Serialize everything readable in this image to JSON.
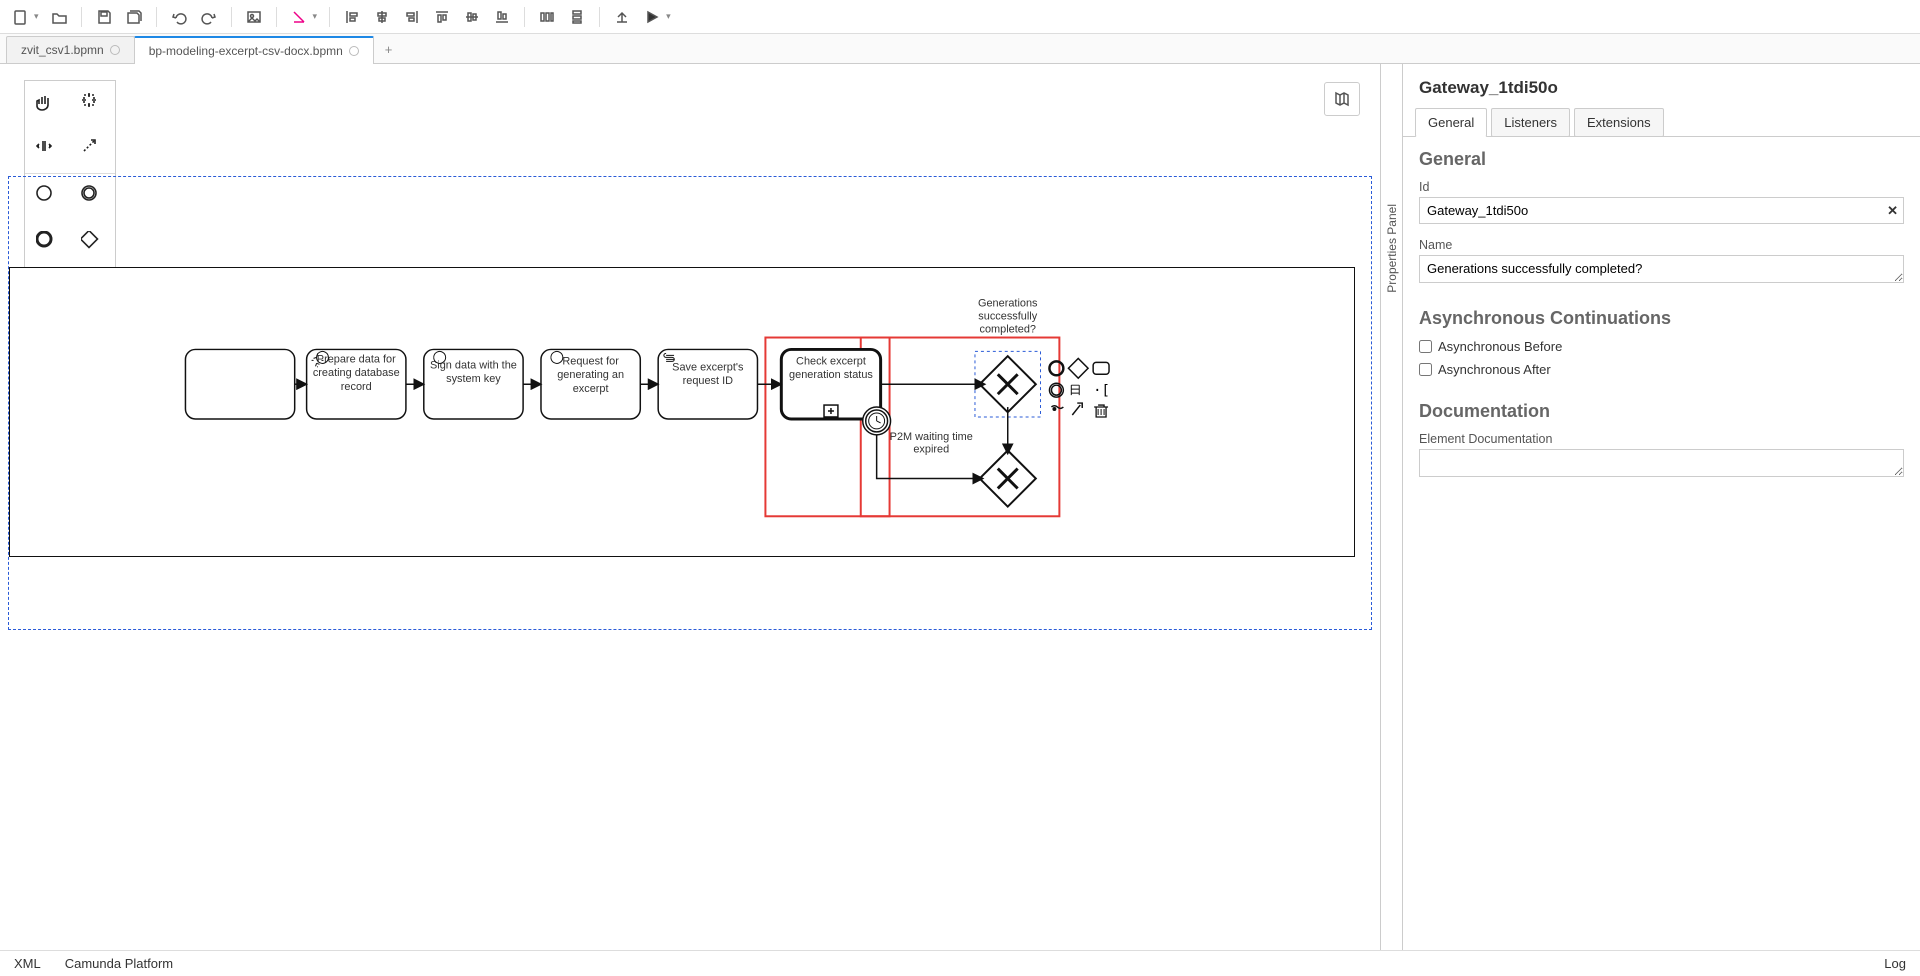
{
  "tabs": {
    "inactive": "zvit_csv1.bpmn",
    "active": "bp-modeling-excerpt-csv-docx.bpmn"
  },
  "diagram": {
    "gateway_label": "Generations\nsuccessfully\ncompleted?",
    "tasks": {
      "prepare": "Prepare data for creating database record",
      "sign": "Sign data with the system key",
      "request": "Request for generating an excerpt",
      "save": "Save excerpt's request ID",
      "check": "Check excerpt generation status",
      "timer": "P2M waiting time expired"
    }
  },
  "properties": {
    "panel_label": "Properties Panel",
    "title": "Gateway_1tdi50o",
    "tabs": {
      "general": "General",
      "listeners": "Listeners",
      "extensions": "Extensions"
    },
    "section_general": "General",
    "id_label": "Id",
    "id_value": "Gateway_1tdi50o",
    "name_label": "Name",
    "name_value": "Generations successfully completed?",
    "section_async": "Asynchronous Continuations",
    "async_before": "Asynchronous Before",
    "async_after": "Asynchronous After",
    "section_doc": "Documentation",
    "doc_label": "Element Documentation"
  },
  "status": {
    "xml": "XML",
    "platform": "Camunda Platform",
    "log": "Log"
  }
}
